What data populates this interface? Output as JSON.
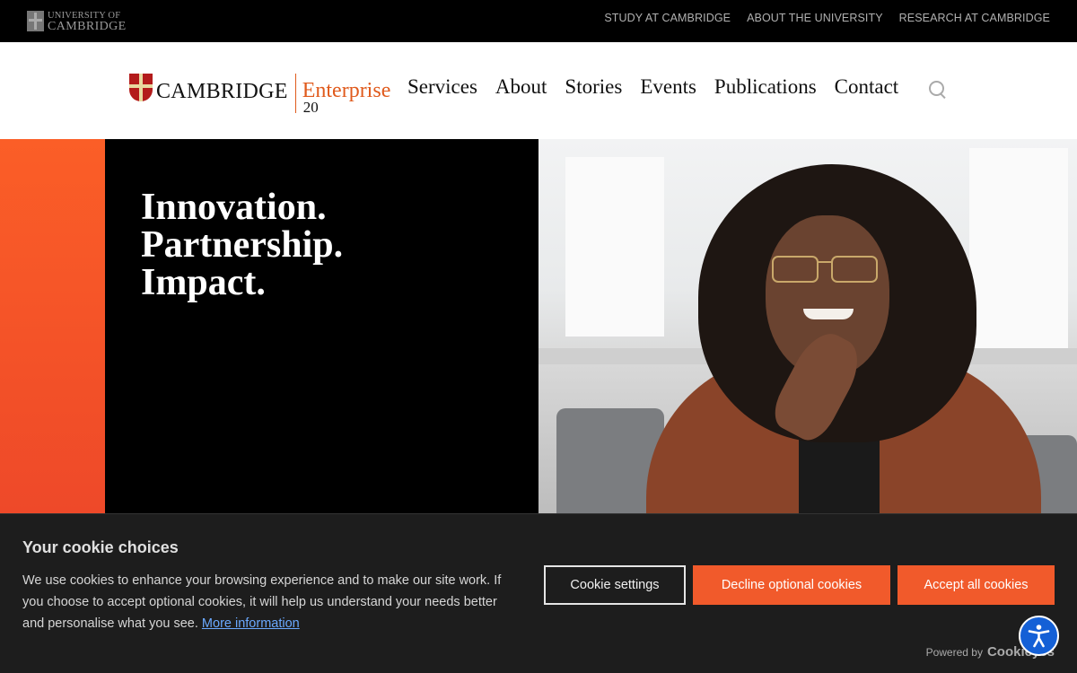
{
  "topbar": {
    "logo_line1": "UNIVERSITY OF",
    "logo_line2": "CAMBRIDGE",
    "links": [
      "STUDY AT CAMBRIDGE",
      "ABOUT THE UNIVERSITY",
      "RESEARCH AT CAMBRIDGE"
    ]
  },
  "header": {
    "brand_name": "CAMBRIDGE",
    "brand_sub": "Enterprise",
    "brand_number": "20",
    "nav": [
      "Services",
      "About",
      "Stories",
      "Events",
      "Publications",
      "Contact"
    ],
    "search_icon": "search-icon"
  },
  "hero": {
    "lines": [
      "Innovation.",
      "Partnership.",
      "Impact."
    ]
  },
  "cookie": {
    "title": "Your cookie choices",
    "text": "We use cookies to enhance your browsing experience and to make our site work. If you choose to accept optional cookies, it will help us understand your needs better and personalise what you see.",
    "more_link": "More information",
    "settings_label": "Cookie settings",
    "decline_label": "Decline optional cookies",
    "accept_label": "Accept all cookies",
    "powered_by": "Powered by",
    "powered_brand": "Cookieyes"
  },
  "colors": {
    "accent": "#f15a2b",
    "topbar_bg": "#000000",
    "banner_bg": "#1d1d1d",
    "a11y_button": "#1460d6"
  }
}
